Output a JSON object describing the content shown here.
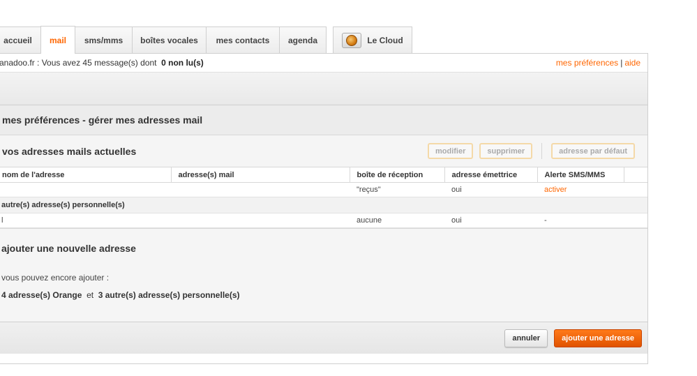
{
  "tabs": [
    {
      "label": "accueil"
    },
    {
      "label": "mail",
      "active": true
    },
    {
      "label": "sms/mms"
    },
    {
      "label": "boîtes vocales"
    },
    {
      "label": "mes contacts"
    },
    {
      "label": "agenda"
    }
  ],
  "cloud_tab": {
    "label": "Le Cloud",
    "icon": "cloud-folder-icon"
  },
  "status": {
    "message_prefix": "anadoo.fr : Vous avez 45 message(s) dont",
    "unread": "0 non lu(s)",
    "preferences_link": "mes préférences",
    "separator": "|",
    "help_link": "aide"
  },
  "section_title": "mes préférences - gérer mes adresses mail",
  "address_list": {
    "title": "vos adresses mails actuelles",
    "buttons": {
      "modify": "modifier",
      "delete": "supprimer",
      "default": "adresse par défaut"
    },
    "columns": [
      "nom de l'adresse",
      "adresse(s) mail",
      "boîte de réception",
      "adresse émettrice",
      "Alerte SMS/MMS"
    ],
    "rows": [
      {
        "name": "",
        "email": "",
        "inbox": "\"reçus\"",
        "sender": "oui",
        "alert": "activer"
      }
    ],
    "group_label": "autre(s) adresse(s) personnelle(s)",
    "group_rows": [
      {
        "name": "l",
        "email": "",
        "inbox": "aucune",
        "sender": "oui",
        "alert": "-"
      }
    ]
  },
  "add_section": {
    "title": "ajouter une nouvelle adresse",
    "hint": "vous pouvez encore ajouter :",
    "orange_count": "4 adresse(s) Orange",
    "conjunction": "et",
    "personal_count": "3 autre(s) adresse(s) personnelle(s)"
  },
  "footer": {
    "cancel": "annuler",
    "add": "ajouter une adresse"
  },
  "colors": {
    "accent": "#ff6600",
    "button_primary": "#e05300"
  }
}
